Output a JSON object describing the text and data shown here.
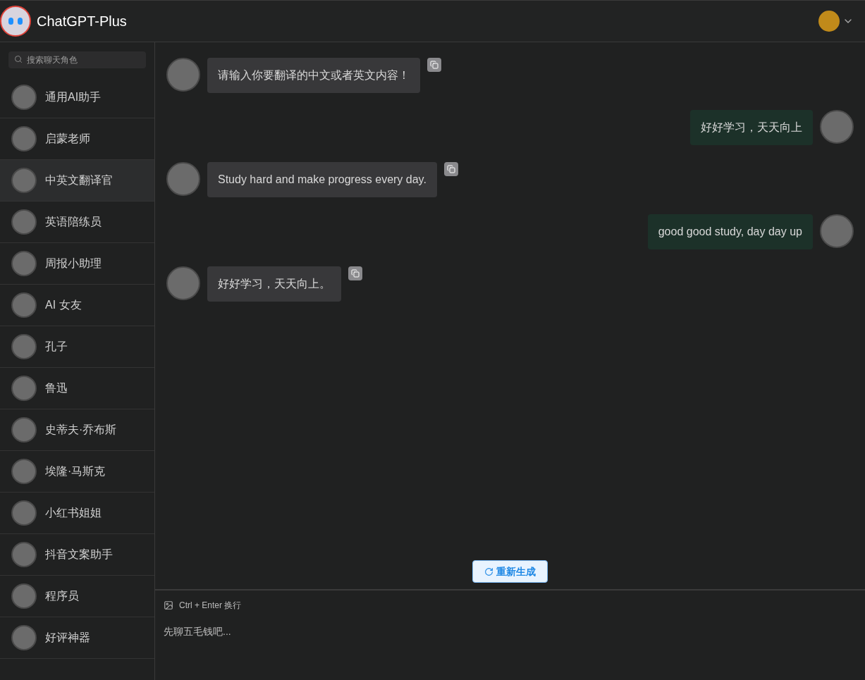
{
  "header": {
    "title": "ChatGPT-Plus"
  },
  "sidebar": {
    "search": {
      "placeholder": "搜索聊天角色"
    },
    "items": [
      {
        "label": "通用AI助手",
        "selected": false
      },
      {
        "label": "启蒙老师",
        "selected": false
      },
      {
        "label": "中英文翻译官",
        "selected": true
      },
      {
        "label": "英语陪练员",
        "selected": false
      },
      {
        "label": "周报小助理",
        "selected": false
      },
      {
        "label": "AI 女友",
        "selected": false
      },
      {
        "label": "孔子",
        "selected": false
      },
      {
        "label": "鲁迅",
        "selected": false
      },
      {
        "label": "史蒂夫·乔布斯",
        "selected": false
      },
      {
        "label": "埃隆·马斯克",
        "selected": false
      },
      {
        "label": "小红书姐姐",
        "selected": false
      },
      {
        "label": "抖音文案助手",
        "selected": false
      },
      {
        "label": "程序员",
        "selected": false
      },
      {
        "label": "好评神器",
        "selected": false
      }
    ]
  },
  "messages": [
    {
      "kind": "bot",
      "text": "请输入你要翻译的中文或者英文内容！"
    },
    {
      "kind": "user",
      "text": "好好学习，天天向上"
    },
    {
      "kind": "bot",
      "text": "Study hard and make progress every day."
    },
    {
      "kind": "user",
      "text": "good good study, day day up"
    },
    {
      "kind": "bot",
      "text": "好好学习，天天向上。"
    }
  ],
  "regenerate_button": {
    "label": "重新生成"
  },
  "composer": {
    "hint": "Ctrl + Enter 换行",
    "placeholder": "先聊五毛钱吧..."
  }
}
